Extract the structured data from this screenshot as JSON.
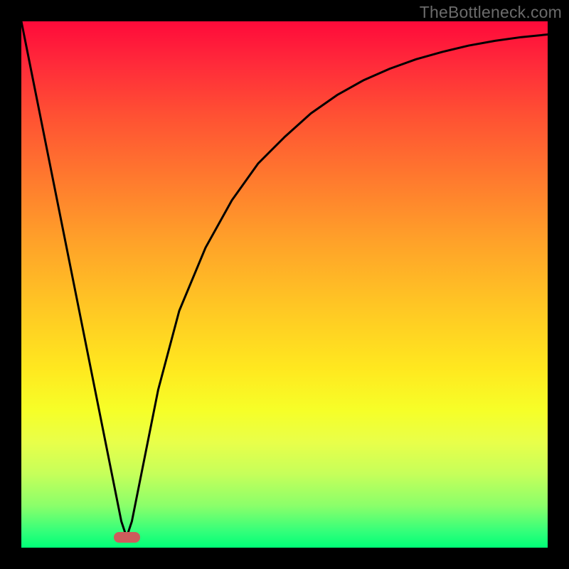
{
  "watermark": "TheBottleneck.com",
  "chart_data": {
    "type": "line",
    "title": "",
    "xlabel": "",
    "ylabel": "",
    "xlim": [
      0,
      100
    ],
    "ylim": [
      0,
      100
    ],
    "grid": false,
    "legend": false,
    "series": [
      {
        "name": "curve",
        "x": [
          0,
          5,
          10,
          14,
          17,
          19,
          20,
          21,
          23,
          26,
          30,
          35,
          40,
          45,
          50,
          55,
          60,
          65,
          70,
          75,
          80,
          85,
          90,
          95,
          100
        ],
        "y": [
          100,
          75,
          50,
          30,
          15,
          5,
          2,
          5,
          15,
          30,
          45,
          57,
          66,
          73,
          78,
          82.5,
          86,
          88.8,
          91,
          92.8,
          94.2,
          95.4,
          96.3,
          97,
          97.5
        ]
      }
    ],
    "marker": {
      "x": 20,
      "y": 2,
      "width": 5,
      "height": 2,
      "color": "#cd5c5c"
    },
    "gradient_stops": [
      {
        "pos": 0,
        "color": "#ff0a3a"
      },
      {
        "pos": 8,
        "color": "#ff2a3a"
      },
      {
        "pos": 18,
        "color": "#ff5133"
      },
      {
        "pos": 30,
        "color": "#ff7a2e"
      },
      {
        "pos": 42,
        "color": "#ffa229"
      },
      {
        "pos": 54,
        "color": "#ffc624"
      },
      {
        "pos": 66,
        "color": "#ffe81f"
      },
      {
        "pos": 74,
        "color": "#f6ff28"
      },
      {
        "pos": 80,
        "color": "#e8ff4a"
      },
      {
        "pos": 86,
        "color": "#c6ff5a"
      },
      {
        "pos": 92,
        "color": "#8bff6a"
      },
      {
        "pos": 97,
        "color": "#32ff7a"
      },
      {
        "pos": 100,
        "color": "#00ff77"
      }
    ]
  }
}
